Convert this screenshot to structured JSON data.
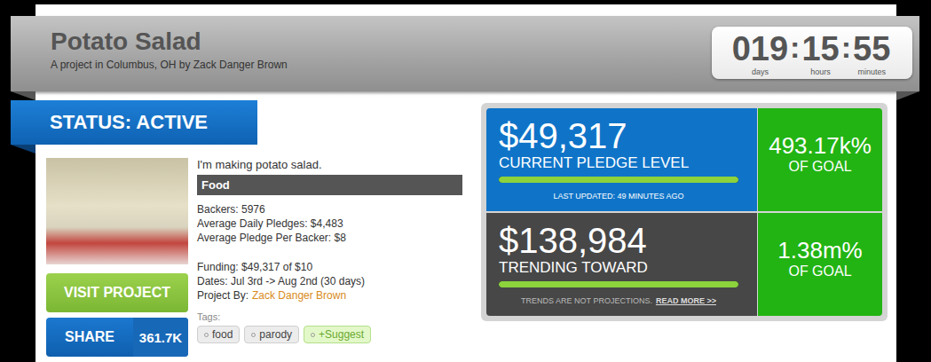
{
  "header": {
    "title": "Potato Salad",
    "subtitle": "A project in Columbus, OH by Zack Danger Brown"
  },
  "countdown": {
    "separator": ":",
    "parts": [
      {
        "value": "019",
        "unit": "days"
      },
      {
        "value": "15",
        "unit": "hours"
      },
      {
        "value": "55",
        "unit": "minutes"
      }
    ]
  },
  "status": "STATUS: ACTIVE",
  "project": {
    "description": "I'm making potato salad.",
    "category": "Food",
    "stats": [
      "Backers: 5976",
      "Average Daily Pledges: $4,483",
      "Average Pledge Per Backer: $8"
    ],
    "funding": [
      "Funding: $49,317 of $10",
      "Dates: Jul 3rd -> Aug 2nd (30 days)"
    ],
    "creator": {
      "label": "Project By:",
      "name": "Zack Danger Brown"
    }
  },
  "buttons": {
    "visit": "VISIT PROJECT",
    "share": {
      "label": "SHARE",
      "count": "361.7K"
    }
  },
  "tags": {
    "label": "Tags:",
    "items": [
      {
        "label": "food",
        "kind": "tag"
      },
      {
        "label": "parody",
        "kind": "tag"
      },
      {
        "label": "+Suggest",
        "kind": "suggest"
      }
    ]
  },
  "metrics": [
    {
      "kind": "current",
      "amount": "$49,317",
      "caption": "CURRENT PLEDGE LEVEL",
      "level": 1,
      "note": "LAST UPDATED: 49 MINUTES AGO",
      "percent": "493.17k%",
      "percent_caption": "OF GOAL"
    },
    {
      "kind": "trend",
      "amount": "$138,984",
      "caption": "TRENDING TOWARD",
      "level": 1,
      "note": "TRENDS ARE NOT PROJECTIONS.",
      "link": "READ MORE >>",
      "percent": "1.38m%",
      "percent_caption": "OF GOAL"
    }
  ]
}
